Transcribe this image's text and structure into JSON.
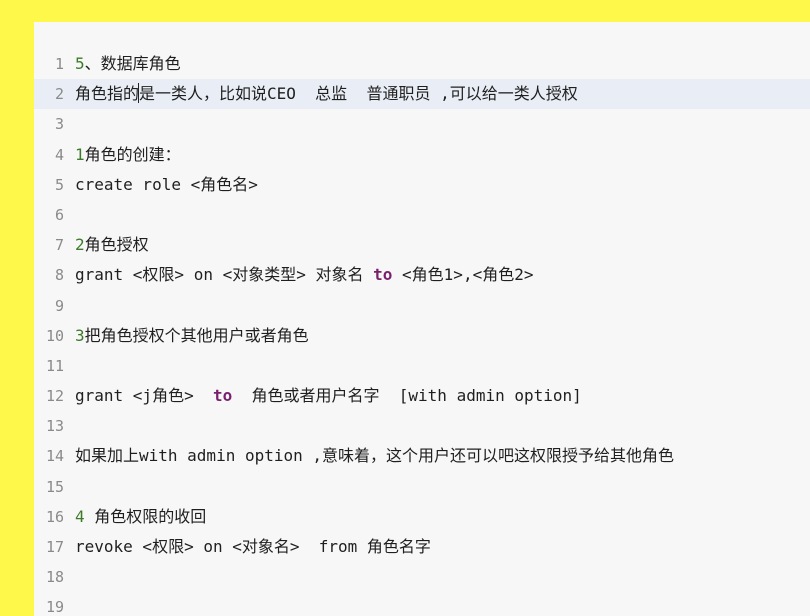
{
  "lines": [
    {
      "n": "1",
      "a": "",
      "p1": "5",
      "b": "、数据库角色",
      "kw": "",
      "c": ""
    },
    {
      "n": "2",
      "a": "角色指的",
      "p1": "",
      "b": "是一类人，比如说CEO  总监  普通职员 ,可以给一类人授权",
      "kw": "",
      "c": "",
      "caret": true
    },
    {
      "n": "3",
      "a": "",
      "p1": "",
      "b": "",
      "kw": "",
      "c": ""
    },
    {
      "n": "4",
      "a": "",
      "p1": "1",
      "b": "角色的创建：",
      "kw": "",
      "c": ""
    },
    {
      "n": "5",
      "a": "create role <角色名>",
      "p1": "",
      "b": "",
      "kw": "",
      "c": ""
    },
    {
      "n": "6",
      "a": "",
      "p1": "",
      "b": "",
      "kw": "",
      "c": ""
    },
    {
      "n": "7",
      "a": "",
      "p1": "2",
      "b": "角色授权",
      "kw": "",
      "c": ""
    },
    {
      "n": "8",
      "a": "grant <权限> on <对象类型> 对象名 ",
      "p1": "",
      "b": "",
      "kw": "to",
      "c": " <角色1>,<角色2>"
    },
    {
      "n": "9",
      "a": "",
      "p1": "",
      "b": "",
      "kw": "",
      "c": ""
    },
    {
      "n": "10",
      "a": "",
      "p1": "3",
      "b": "把角色授权个其他用户或者角色",
      "kw": "",
      "c": ""
    },
    {
      "n": "11",
      "a": "",
      "p1": "",
      "b": "",
      "kw": "",
      "c": ""
    },
    {
      "n": "12",
      "a": "grant <j角色>  ",
      "p1": "",
      "b": "",
      "kw": "to",
      "c": "  角色或者用户名字  [with admin option]"
    },
    {
      "n": "13",
      "a": "",
      "p1": "",
      "b": "",
      "kw": "",
      "c": ""
    },
    {
      "n": "14",
      "a": "如果加上with admin option ,意味着，这个用户还可以吧这权限授予给其他角色",
      "p1": "",
      "b": "",
      "kw": "",
      "c": ""
    },
    {
      "n": "15",
      "a": "",
      "p1": "",
      "b": "",
      "kw": "",
      "c": ""
    },
    {
      "n": "16",
      "a": "",
      "p1": "4",
      "b": " 角色权限的收回",
      "kw": "",
      "c": ""
    },
    {
      "n": "17",
      "a": "revoke <权限> on <对象名>  from 角色名字",
      "p1": "",
      "b": "",
      "kw": "",
      "c": ""
    },
    {
      "n": "18",
      "a": "",
      "p1": "",
      "b": "",
      "kw": "",
      "c": ""
    },
    {
      "n": "19",
      "a": "",
      "p1": "",
      "b": "",
      "kw": "",
      "c": ""
    }
  ]
}
